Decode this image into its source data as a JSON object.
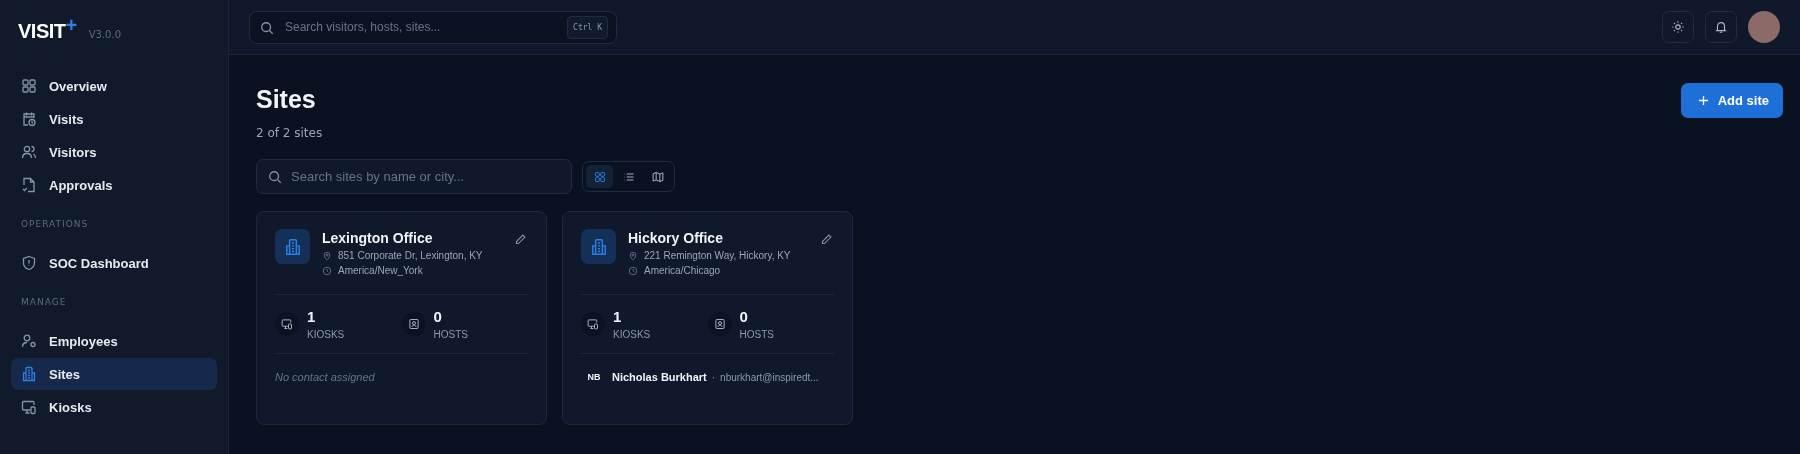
{
  "brand": {
    "logo": "VISIT",
    "logo_mark": "+",
    "version": "V3.0.0"
  },
  "sidebar": {
    "groups": [
      {
        "items": [
          {
            "label": "Overview",
            "selected": false
          },
          {
            "label": "Visits",
            "selected": false
          },
          {
            "label": "Visitors",
            "selected": false
          },
          {
            "label": "Approvals",
            "selected": false
          }
        ]
      },
      {
        "heading": "OPERATIONS",
        "items": [
          {
            "label": "SOC Dashboard",
            "selected": false
          }
        ]
      },
      {
        "heading": "MANAGE",
        "items": [
          {
            "label": "Employees",
            "selected": false
          },
          {
            "label": "Sites",
            "selected": true
          },
          {
            "label": "Kiosks",
            "selected": false
          }
        ]
      }
    ]
  },
  "topbar": {
    "search": {
      "placeholder": "Search visitors, hosts, sites...",
      "shortcut": "Ctrl K"
    }
  },
  "page": {
    "title": "Sites",
    "subtitle": "2 of 2 sites",
    "add_button": "Add site",
    "filter": {
      "placeholder": "Search sites by name or city..."
    },
    "views": [
      {
        "kind": "grid",
        "selected": true
      },
      {
        "kind": "list",
        "selected": false
      },
      {
        "kind": "map",
        "selected": false
      }
    ],
    "sites": [
      {
        "name": "Lexington Office",
        "address": "851 Corporate Dr, Lexington, KY",
        "timezone": "America/New_York",
        "stats": [
          {
            "kind": "kiosks",
            "value": "1",
            "label": "KIOSKS"
          },
          {
            "kind": "hosts",
            "value": "0",
            "label": "HOSTS"
          }
        ],
        "contact": {
          "kind": "none",
          "text": "No contact assigned"
        }
      },
      {
        "name": "Hickory Office",
        "address": "221 Remington Way, Hickory, KY",
        "timezone": "America/Chicago",
        "stats": [
          {
            "kind": "kiosks",
            "value": "1",
            "label": "KIOSKS"
          },
          {
            "kind": "hosts",
            "value": "0",
            "label": "HOSTS"
          }
        ],
        "contact": {
          "kind": "person",
          "initials": "NB",
          "name": "Nicholas Burkhart",
          "separator": "·",
          "email": "nburkhart@inspiredt..."
        }
      }
    ]
  }
}
